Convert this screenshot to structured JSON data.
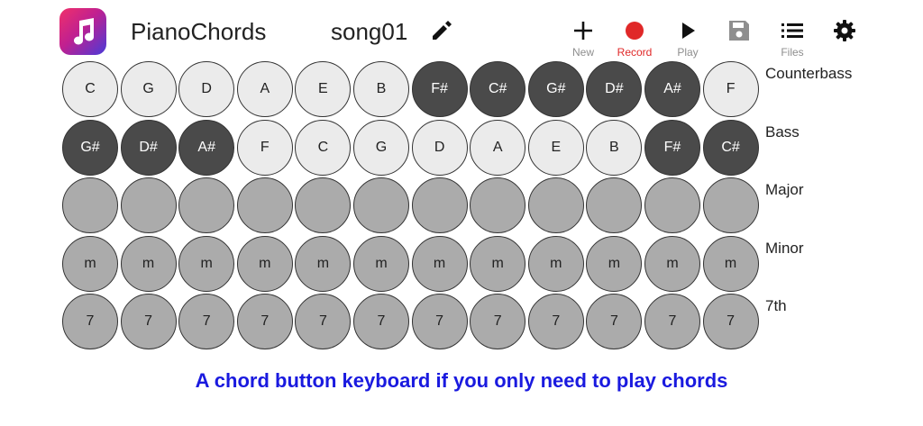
{
  "header": {
    "app_icon": "music-note-icon",
    "app_title": "PianoChords",
    "song_title": "song01",
    "edit_icon": "pencil-icon"
  },
  "toolbar": [
    {
      "name": "new-button",
      "icon": "plus-icon",
      "label": "New"
    },
    {
      "name": "record-button",
      "icon": "record-icon",
      "label": "Record",
      "color": "#e02828"
    },
    {
      "name": "play-button",
      "icon": "play-icon",
      "label": "Play"
    },
    {
      "name": "save-button",
      "icon": "floppy-disk-icon",
      "label": ""
    },
    {
      "name": "files-button",
      "icon": "list-icon",
      "label": "Files"
    },
    {
      "name": "settings-button",
      "icon": "gear-icon",
      "label": ""
    }
  ],
  "rows": [
    {
      "label": "Counterbass",
      "keys": [
        {
          "t": "C",
          "s": "light"
        },
        {
          "t": "G",
          "s": "light"
        },
        {
          "t": "D",
          "s": "light"
        },
        {
          "t": "A",
          "s": "light"
        },
        {
          "t": "E",
          "s": "light"
        },
        {
          "t": "B",
          "s": "light"
        },
        {
          "t": "F#",
          "s": "dark"
        },
        {
          "t": "C#",
          "s": "dark"
        },
        {
          "t": "G#",
          "s": "dark"
        },
        {
          "t": "D#",
          "s": "dark"
        },
        {
          "t": "A#",
          "s": "dark"
        },
        {
          "t": "F",
          "s": "light"
        }
      ]
    },
    {
      "label": "Bass",
      "keys": [
        {
          "t": "G#",
          "s": "dark"
        },
        {
          "t": "D#",
          "s": "dark"
        },
        {
          "t": "A#",
          "s": "dark"
        },
        {
          "t": "F",
          "s": "light"
        },
        {
          "t": "C",
          "s": "light"
        },
        {
          "t": "G",
          "s": "light"
        },
        {
          "t": "D",
          "s": "light"
        },
        {
          "t": "A",
          "s": "light"
        },
        {
          "t": "E",
          "s": "light"
        },
        {
          "t": "B",
          "s": "light"
        },
        {
          "t": "F#",
          "s": "dark"
        },
        {
          "t": "C#",
          "s": "dark"
        }
      ]
    },
    {
      "label": "Major",
      "keys": [
        {
          "t": "",
          "s": "grey"
        },
        {
          "t": "",
          "s": "grey"
        },
        {
          "t": "",
          "s": "grey"
        },
        {
          "t": "",
          "s": "grey"
        },
        {
          "t": "",
          "s": "grey"
        },
        {
          "t": "",
          "s": "grey"
        },
        {
          "t": "",
          "s": "grey"
        },
        {
          "t": "",
          "s": "grey"
        },
        {
          "t": "",
          "s": "grey"
        },
        {
          "t": "",
          "s": "grey"
        },
        {
          "t": "",
          "s": "grey"
        },
        {
          "t": "",
          "s": "grey"
        }
      ]
    },
    {
      "label": "Minor",
      "keys": [
        {
          "t": "m",
          "s": "grey"
        },
        {
          "t": "m",
          "s": "grey"
        },
        {
          "t": "m",
          "s": "grey"
        },
        {
          "t": "m",
          "s": "grey"
        },
        {
          "t": "m",
          "s": "grey"
        },
        {
          "t": "m",
          "s": "grey"
        },
        {
          "t": "m",
          "s": "grey"
        },
        {
          "t": "m",
          "s": "grey"
        },
        {
          "t": "m",
          "s": "grey"
        },
        {
          "t": "m",
          "s": "grey"
        },
        {
          "t": "m",
          "s": "grey"
        },
        {
          "t": "m",
          "s": "grey"
        }
      ]
    },
    {
      "label": "7th",
      "keys": [
        {
          "t": "7",
          "s": "grey"
        },
        {
          "t": "7",
          "s": "grey"
        },
        {
          "t": "7",
          "s": "grey"
        },
        {
          "t": "7",
          "s": "grey"
        },
        {
          "t": "7",
          "s": "grey"
        },
        {
          "t": "7",
          "s": "grey"
        },
        {
          "t": "7",
          "s": "grey"
        },
        {
          "t": "7",
          "s": "grey"
        },
        {
          "t": "7",
          "s": "grey"
        },
        {
          "t": "7",
          "s": "grey"
        },
        {
          "t": "7",
          "s": "grey"
        },
        {
          "t": "7",
          "s": "grey"
        }
      ]
    }
  ],
  "caption": "A chord button keyboard if you only need to play chords",
  "colors": {
    "caption": "#1a1adf",
    "record": "#e02828",
    "dark_key": "#4a4a4a",
    "light_key": "#ebebeb",
    "grey_key": "#ababab"
  }
}
